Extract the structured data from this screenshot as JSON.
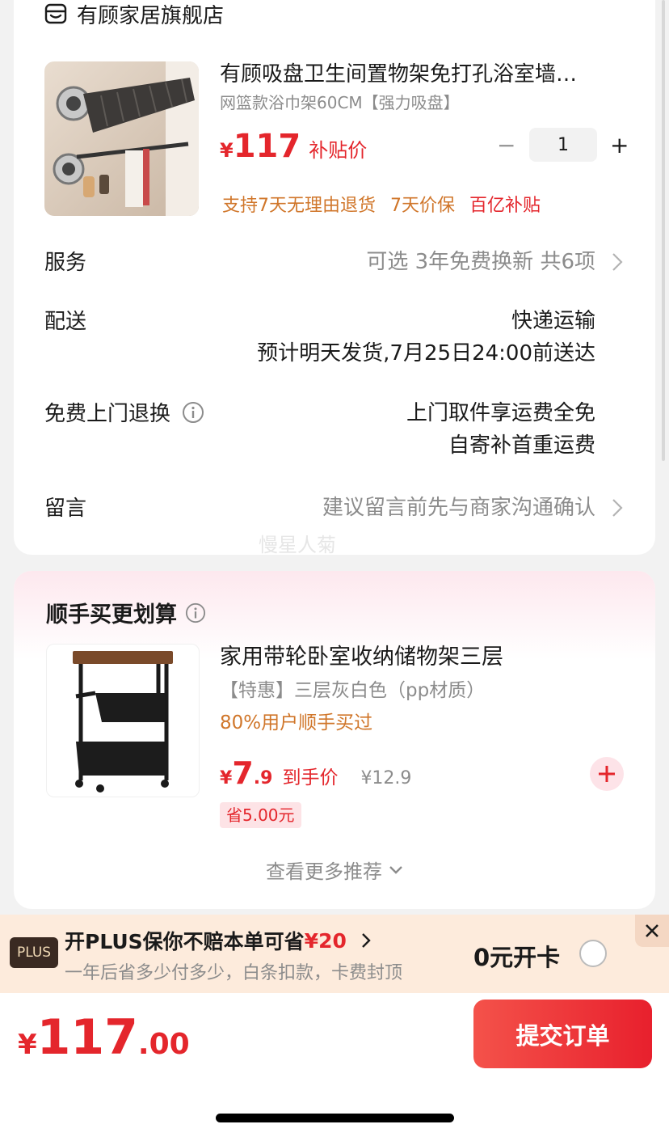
{
  "store": {
    "name": "有顾家居旗舰店",
    "icon": "store-icon"
  },
  "product": {
    "title": "有顾吸盘卫生间置物架免打孔浴室墙…",
    "spec": "网篮款浴巾架60CM【强力吸盘】",
    "price_symbol": "¥",
    "price": "117",
    "price_tag": "补贴价",
    "quantity": "1",
    "qty_minus": "−",
    "qty_plus": "+",
    "tags": [
      "支持7天无理由退货",
      "7天价保",
      "百亿补贴"
    ]
  },
  "service": {
    "label": "服务",
    "value": "可选 3年免费换新 共6项"
  },
  "delivery": {
    "label": "配送",
    "method": "快递运输",
    "estimate": "预计明天发货,7月25日24:00前送达"
  },
  "return": {
    "label": "免费上门退换",
    "line1": "上门取件享运费全免",
    "line2": "自寄补首重运费"
  },
  "message": {
    "label": "留言",
    "placeholder": "建议留言前先与商家沟通确认"
  },
  "watermark": "慢星人菊",
  "recommend": {
    "section_title": "顺手买更划算",
    "title": "家用带轮卧室收纳储物架三层",
    "spec": "【特惠】三层灰白色（pp材质）",
    "buyers": "80%用户顺手买过",
    "price_symbol": "¥",
    "price_int": "7",
    "price_dec": ".9",
    "price_tag": "到手价",
    "original_price": "¥12.9",
    "save": "省5.00元",
    "more": "查看更多推荐"
  },
  "plus": {
    "badge": "PLUS",
    "title_prefix": "开PLUS保你不赔本单可省",
    "title_amount": "¥20",
    "subtitle": "一年后省多少付多少，白条扣款，卡费封顶",
    "card_label": "0元开卡"
  },
  "checkout": {
    "total_symbol": "¥",
    "total_int": "117",
    "total_dec": ".00",
    "submit_label": "提交订单"
  },
  "colors": {
    "accent_red": "#e4262c",
    "accent_orange": "#d0762a",
    "plus_bg": "#fdebdc"
  }
}
